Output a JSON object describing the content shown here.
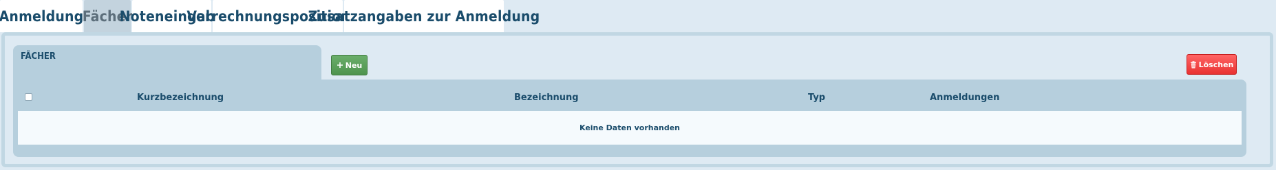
{
  "tabs": [
    {
      "label": "Anmeldung",
      "active": false
    },
    {
      "label": "Fächer",
      "active": true
    },
    {
      "label": "Noteneingabe",
      "active": false
    },
    {
      "label": "Verrechnungspositionen",
      "active": false
    },
    {
      "label": "Zusatzangaben zur Anmeldung",
      "active": false
    }
  ],
  "section": {
    "title": "FÄCHER"
  },
  "toolbar": {
    "new_label": "Neu",
    "new_icon": "plus-icon",
    "delete_label": "Löschen",
    "delete_icon": "trash-icon"
  },
  "table": {
    "columns": [
      "Kurzbezeichnung",
      "Bezeichnung",
      "Typ",
      "Anmeldungen"
    ],
    "empty_message": "Keine Daten vorhanden"
  },
  "colors": {
    "accent": "#1a4c6b",
    "new_button": "#5ba15b",
    "delete_button": "#f04444",
    "header_bg": "#b6cfdd"
  }
}
